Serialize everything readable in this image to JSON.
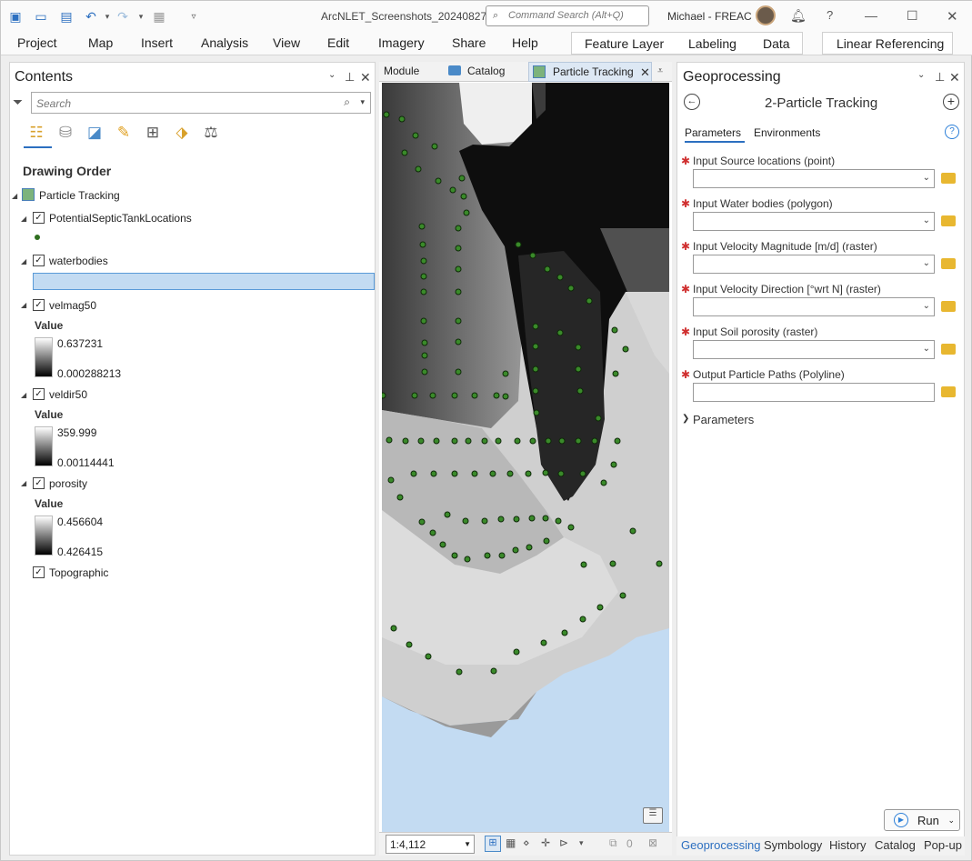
{
  "app": {
    "title": "ArcNLET_Screenshots_20240827",
    "command_search_placeholder": "Command Search (Alt+Q)",
    "user": "Michael - FREAC",
    "help": "?",
    "accent_color": "#2c6fc0"
  },
  "ribbon": {
    "tabs": [
      "Project",
      "Map",
      "Insert",
      "Analysis",
      "View",
      "Edit",
      "Imagery",
      "Share",
      "Help"
    ],
    "contextual_tabs": [
      "Feature Layer",
      "Labeling",
      "Data"
    ],
    "extra_tab": "Linear Referencing"
  },
  "contents": {
    "title": "Contents",
    "search_placeholder": "Search",
    "section": "Drawing Order",
    "map_name": "Particle Tracking",
    "layers": [
      {
        "name": "PotentialSepticTankLocations"
      },
      {
        "name": "waterbodies"
      },
      {
        "name": "velmag50",
        "value_label": "Value",
        "max": "0.637231",
        "min": "0.000288213"
      },
      {
        "name": "veldir50",
        "value_label": "Value",
        "max": "359.999",
        "min": "0.00114441"
      },
      {
        "name": "porosity",
        "value_label": "Value",
        "max": "0.456604",
        "min": "0.426415"
      },
      {
        "name": "Topographic"
      }
    ]
  },
  "mapview": {
    "tabs": [
      "Module",
      "Catalog",
      "Particle Tracking"
    ],
    "scale": "1:4,112",
    "selected_count": "0",
    "point_color": "#3a8a2a",
    "water_color": "#c3dbf2"
  },
  "geoprocessing": {
    "title": "Geoprocessing",
    "tool_name": "2-Particle Tracking",
    "tabs": [
      "Parameters",
      "Environments"
    ],
    "params": [
      "Input Source locations (point)",
      "Input Water bodies (polygon)",
      "Input Velocity Magnitude [m/d] (raster)",
      "Input Velocity Direction [°wrt N] (raster)",
      "Input Soil porosity (raster)",
      "Output Particle Paths (Polyline)"
    ],
    "group": "Parameters",
    "run_label": "Run"
  },
  "bottom_tabs": [
    "Geoprocessing",
    "Symbology",
    "History",
    "Catalog",
    "Pop-up"
  ]
}
